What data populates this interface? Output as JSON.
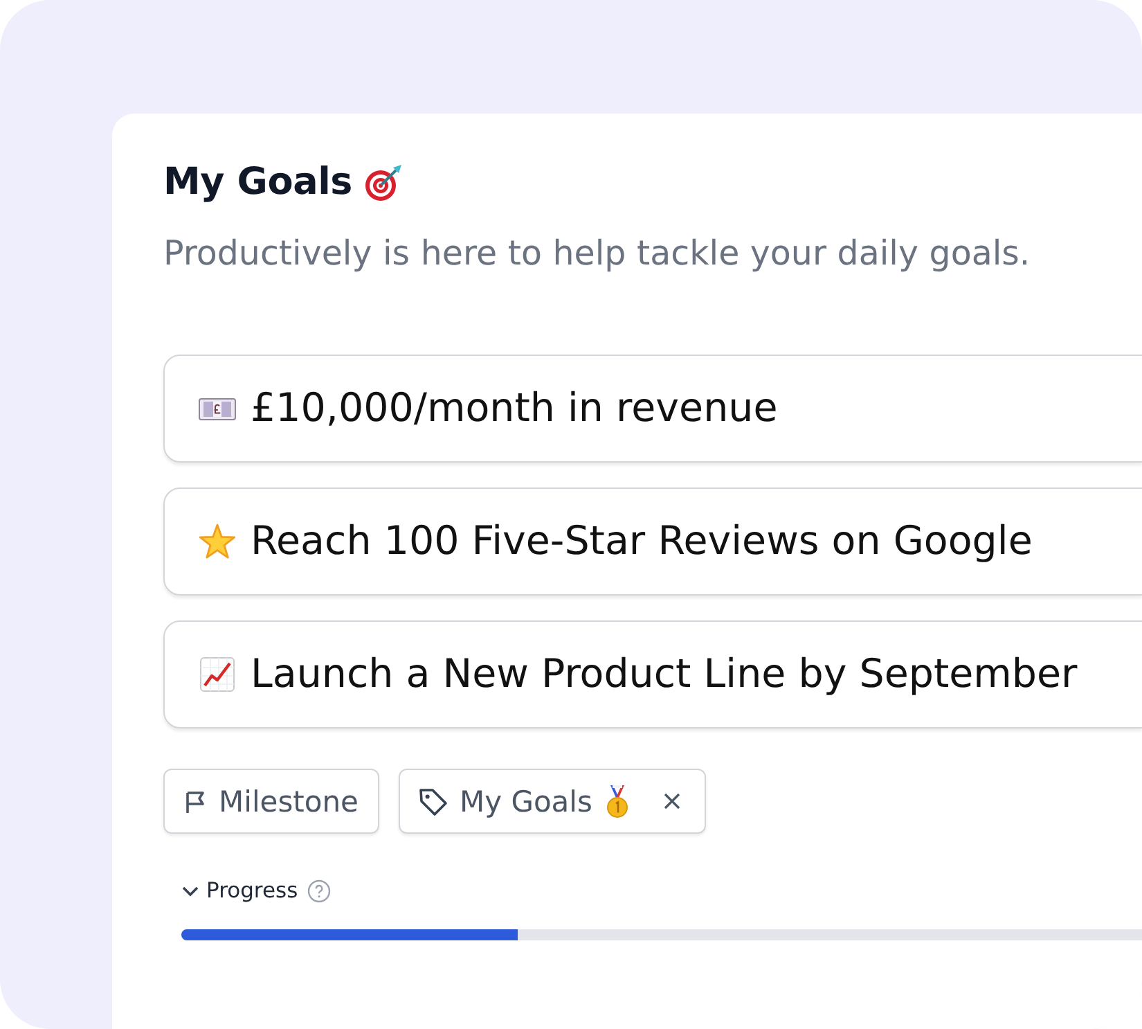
{
  "header": {
    "title": "My Goals",
    "subtitle": "Productively is here to help tackle your daily goals."
  },
  "goals": [
    {
      "kind": "money",
      "text": "£10,000/month in revenue"
    },
    {
      "kind": "star",
      "text": "Reach 100 Five-Star Reviews on Google"
    },
    {
      "kind": "chart",
      "text": "Launch a New Product Line by September"
    }
  ],
  "tags": [
    {
      "kind": "milestone",
      "label": "Milestone",
      "removable": false
    },
    {
      "kind": "goal",
      "label": "My Goals",
      "removable": true
    }
  ],
  "progress": {
    "label": "Progress",
    "expanded": true,
    "level": 0.35
  }
}
